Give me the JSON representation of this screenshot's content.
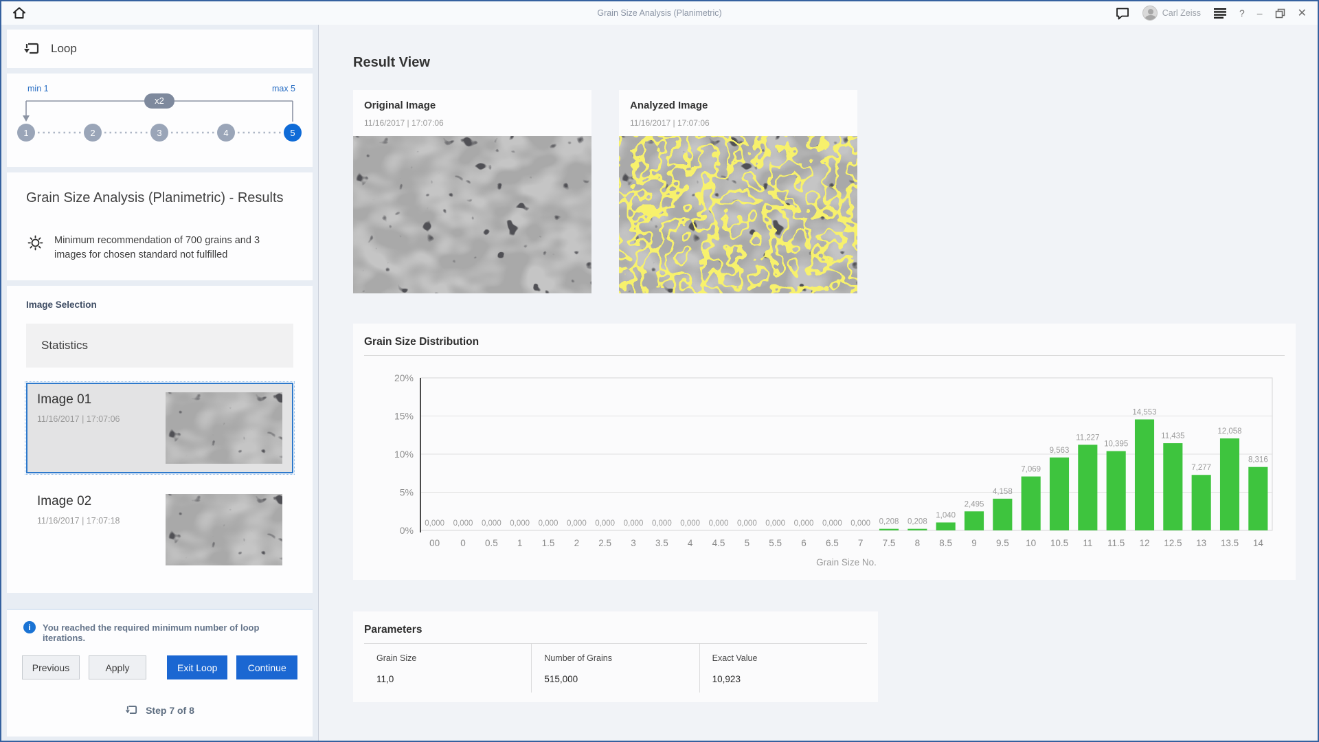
{
  "titlebar": {
    "title": "Grain Size Analysis (Planimetric)",
    "user_name": "Carl Zeiss",
    "help_label": "?",
    "minimize_label": "–",
    "close_label": "✕"
  },
  "icons": [
    "home-icon",
    "chat-icon",
    "avatar",
    "menu-icon",
    "help-icon",
    "minimize-icon",
    "restore-icon",
    "close-icon",
    "loop-icon",
    "hint-icon",
    "info-icon"
  ],
  "loop_panel": {
    "header_label": "Loop",
    "stepper": {
      "min_label": "min 1",
      "max_label": "max 5",
      "multiplier_label": "x2",
      "steps": [
        "1",
        "2",
        "3",
        "4",
        "5"
      ],
      "active_step": "5"
    },
    "results_title": "Grain Size Analysis (Planimetric) - Results",
    "warning_text": "Minimum recommendation of 700 grains and 3 images for chosen standard not fulfilled",
    "image_selection": {
      "title": "Image Selection",
      "statistics_label": "Statistics",
      "items": [
        {
          "name": "Image 01",
          "timestamp": "11/16/2017 | 17:07:06",
          "selected": true
        },
        {
          "name": "Image 02",
          "timestamp": "11/16/2017 | 17:07:18",
          "selected": false
        }
      ]
    },
    "footer": {
      "info_message": "You reached the required minimum number of loop iterations.",
      "previous_label": "Previous",
      "apply_label": "Apply",
      "exit_loop_label": "Exit Loop",
      "continue_label": "Continue",
      "step_label": "Step 7 of 8"
    }
  },
  "main": {
    "title": "Result View",
    "original_image": {
      "title": "Original Image",
      "timestamp": "11/16/2017 | 17:07:06"
    },
    "analyzed_image": {
      "title": "Analyzed Image",
      "timestamp": "11/16/2017 | 17:07:06"
    },
    "parameters": {
      "title": "Parameters",
      "fields": [
        {
          "label": "Grain Size",
          "value": "11,0"
        },
        {
          "label": "Number of Grains",
          "value": "515,000"
        },
        {
          "label": "Exact Value",
          "value": "10,923"
        }
      ]
    }
  },
  "chart_data": {
    "type": "bar",
    "title": "Grain Size Distribution",
    "xlabel": "Grain Size No.",
    "ylabel": "",
    "ylim": [
      0,
      20
    ],
    "ytick_values": [
      0,
      5,
      10,
      15,
      20
    ],
    "ytick_labels": [
      "0%",
      "5%",
      "10%",
      "15%",
      "20%"
    ],
    "grid": true,
    "legend": false,
    "categories": [
      "00",
      "0",
      "0.5",
      "1",
      "1.5",
      "2",
      "2.5",
      "3",
      "3.5",
      "4",
      "4.5",
      "5",
      "5.5",
      "6",
      "6.5",
      "7",
      "7.5",
      "8",
      "8.5",
      "9",
      "9.5",
      "10",
      "10.5",
      "11",
      "11.5",
      "12",
      "12.5",
      "13",
      "13.5",
      "14"
    ],
    "values": [
      0,
      0,
      0,
      0,
      0,
      0,
      0,
      0,
      0,
      0,
      0,
      0,
      0,
      0,
      0,
      0,
      0.208,
      0.208,
      1.04,
      2.495,
      4.158,
      7.069,
      9.563,
      11.227,
      10.395,
      14.553,
      11.435,
      7.277,
      12.058,
      8.316
    ],
    "bar_labels": [
      "0,000",
      "0,000",
      "0,000",
      "0,000",
      "0,000",
      "0,000",
      "0,000",
      "0,000",
      "0,000",
      "0,000",
      "0,000",
      "0,000",
      "0,000",
      "0,000",
      "0,000",
      "0,000",
      "0,208",
      "0,208",
      "1,040",
      "2,495",
      "4,158",
      "7,069",
      "9,563",
      "11,227",
      "10,395",
      "14,553",
      "11,435",
      "7,277",
      "12,058",
      "8,316"
    ],
    "bar_color": "#3ec43e"
  },
  "colors": {
    "accent_blue": "#1b67d2",
    "bar_green": "#3ec43e",
    "window_border": "#35619f",
    "step_inactive": "#9aa5b8",
    "step_active": "#0f6bd7"
  }
}
